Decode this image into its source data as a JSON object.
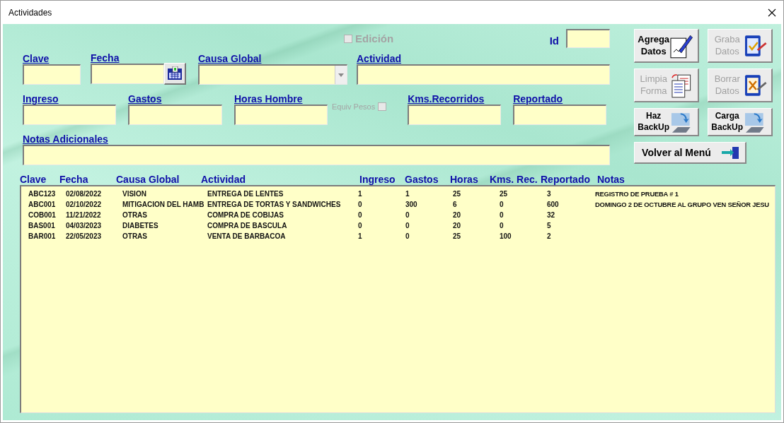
{
  "window": {
    "title": "Actividades"
  },
  "edit_toggle": {
    "label": "Edición",
    "checked": false,
    "disabled": true
  },
  "id_field": {
    "label": "Id"
  },
  "form_rows": [
    [
      {
        "label": "Clave",
        "kind": "text"
      },
      {
        "label": "Fecha",
        "kind": "date"
      },
      {
        "label": "Causa Global",
        "kind": "dropdown"
      },
      {
        "label": "Actividad",
        "kind": "text"
      }
    ],
    [
      {
        "label": "Ingreso",
        "kind": "text"
      },
      {
        "label": "Gastos",
        "kind": "text"
      },
      {
        "label": "Horas Hombre",
        "kind": "text"
      },
      {
        "label": "Equiv Pesos",
        "kind": "checkbox",
        "checked": false,
        "disabled": true
      },
      {
        "label": "Kms.Recorridos",
        "kind": "text"
      },
      {
        "label": "Reportado",
        "kind": "text"
      }
    ],
    [
      {
        "label": "Notas Adicionales",
        "kind": "text"
      }
    ]
  ],
  "buttons": [
    {
      "label": "Agrega Datos",
      "disabled": false,
      "kind": "tile"
    },
    {
      "label": "Graba Datos",
      "disabled": true,
      "kind": "tile"
    },
    {
      "label": "Limpia Forma",
      "disabled": true,
      "kind": "tile"
    },
    {
      "label": "Borrar Datos",
      "disabled": true,
      "kind": "tile"
    },
    {
      "label": "Haz BackUp",
      "disabled": false,
      "kind": "small"
    },
    {
      "label": "Carga BackUp",
      "disabled": false,
      "kind": "small"
    },
    {
      "label": "Volver al Menú",
      "disabled": false,
      "kind": "wide"
    }
  ],
  "table": {
    "columns": [
      "Clave",
      "Fecha",
      "Causa Global",
      "Actividad",
      "Ingreso",
      "Gastos",
      "Horas",
      "Kms. Rec.",
      "Reportado",
      "Notas"
    ],
    "rows": [
      [
        "ABC123",
        "02/08/2022",
        "VISION",
        "ENTREGA DE LENTES",
        "1",
        "1",
        "25",
        "25",
        "3",
        "REGISTRO DE PRUEBA # 1"
      ],
      [
        "ABC001",
        "02/10/2022",
        "MITIGACION DEL HAMB",
        "ENTREGA DE TORTAS Y SANDWICHES",
        "0",
        "300",
        "6",
        "0",
        "600",
        "DOMINGO 2 DE OCTUBRE AL GRUPO VEN SEÑOR JESU"
      ],
      [
        "COB001",
        "11/21/2022",
        "OTRAS",
        "COMPRA DE COBIJAS",
        "0",
        "0",
        "20",
        "0",
        "32"
      ],
      [
        "BAS001",
        "04/03/2023",
        "DIABETES",
        "COMPRA DE BASCULA",
        "0",
        "0",
        "20",
        "0",
        "5"
      ],
      [
        "BAR001",
        "22/05/2023",
        "OTRAS",
        "VENTA DE BARBACOA",
        "1",
        "0",
        "25",
        "100",
        "2"
      ]
    ]
  }
}
